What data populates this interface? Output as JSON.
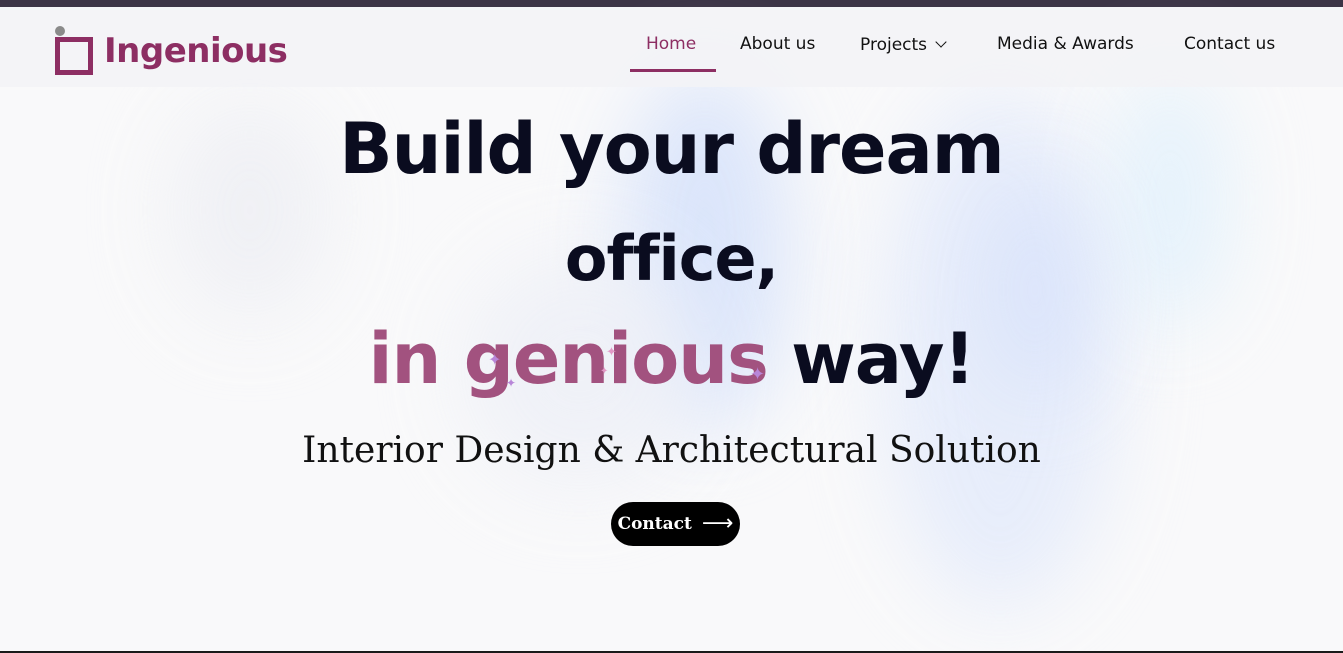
{
  "brand": {
    "name": "Ingenious",
    "color": "#8d2e63"
  },
  "nav": {
    "items": [
      {
        "label": "Home",
        "active": true
      },
      {
        "label": "About us",
        "active": false
      },
      {
        "label": "Projects",
        "active": false,
        "has_dropdown": true
      },
      {
        "label": "Media & Awards",
        "active": false
      },
      {
        "label": "Contact us",
        "active": false
      }
    ],
    "dropdown_icon": "chevron-down-icon"
  },
  "hero": {
    "line1": "Build your dream",
    "line2": "office,",
    "line3_accent": "in genious",
    "line3_rest": " way!",
    "accent_color": "#a2527f",
    "subtitle": "Interior Design & Architectural Solution",
    "cta_label": "Contact",
    "cta_icon": "arrow-right-icon"
  },
  "colors": {
    "top_bar": "#3c3446",
    "text": "#0a0c1f",
    "button": "#000000"
  }
}
